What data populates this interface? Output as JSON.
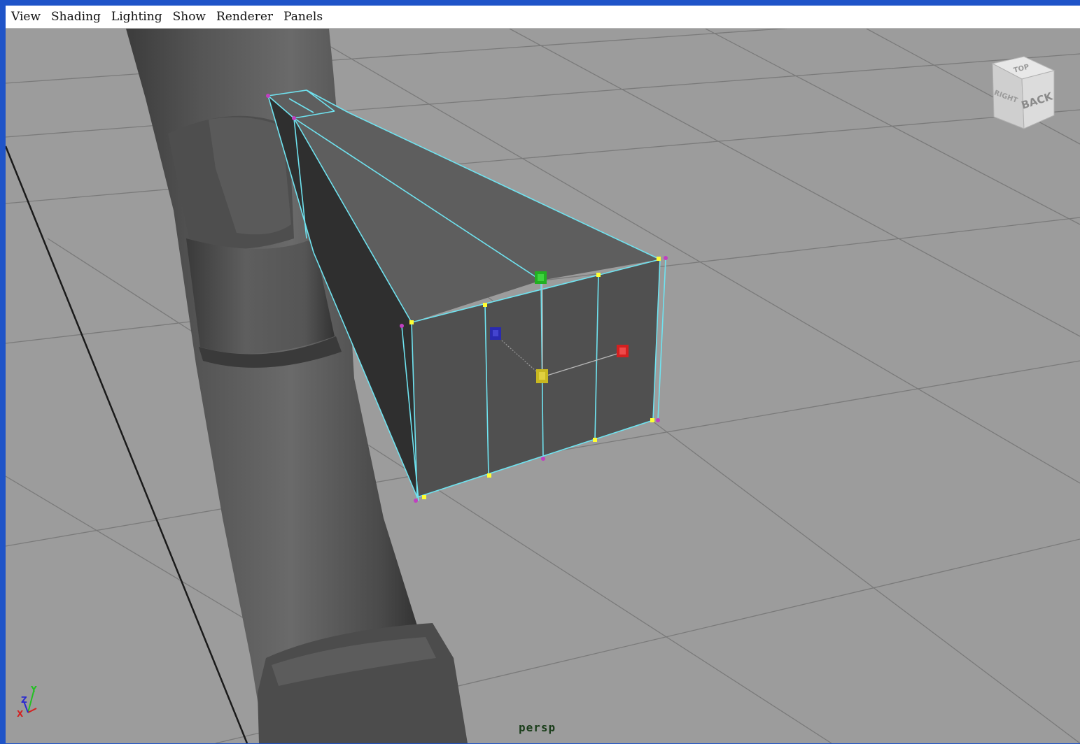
{
  "menubar": {
    "items": [
      "View",
      "Shading",
      "Lighting",
      "Show",
      "Renderer",
      "Panels"
    ]
  },
  "viewport": {
    "camera_label": "persp"
  },
  "viewcube": {
    "front_face": "BACK",
    "side_face": "RIGHT",
    "top_face": "TOP"
  },
  "axis_gizmo": {
    "x": "X",
    "y": "Y",
    "z": "Z"
  },
  "colors": {
    "frame_blue": "#1f54c8",
    "viewport_bg": "#9c9c9c",
    "wireframe_cyan": "#6fe3f0",
    "vertex_yellow": "#ffff33",
    "manip_red": "#d42020",
    "manip_green": "#22b022",
    "manip_blue": "#2a2ab0",
    "manip_center": "#c8b820"
  }
}
